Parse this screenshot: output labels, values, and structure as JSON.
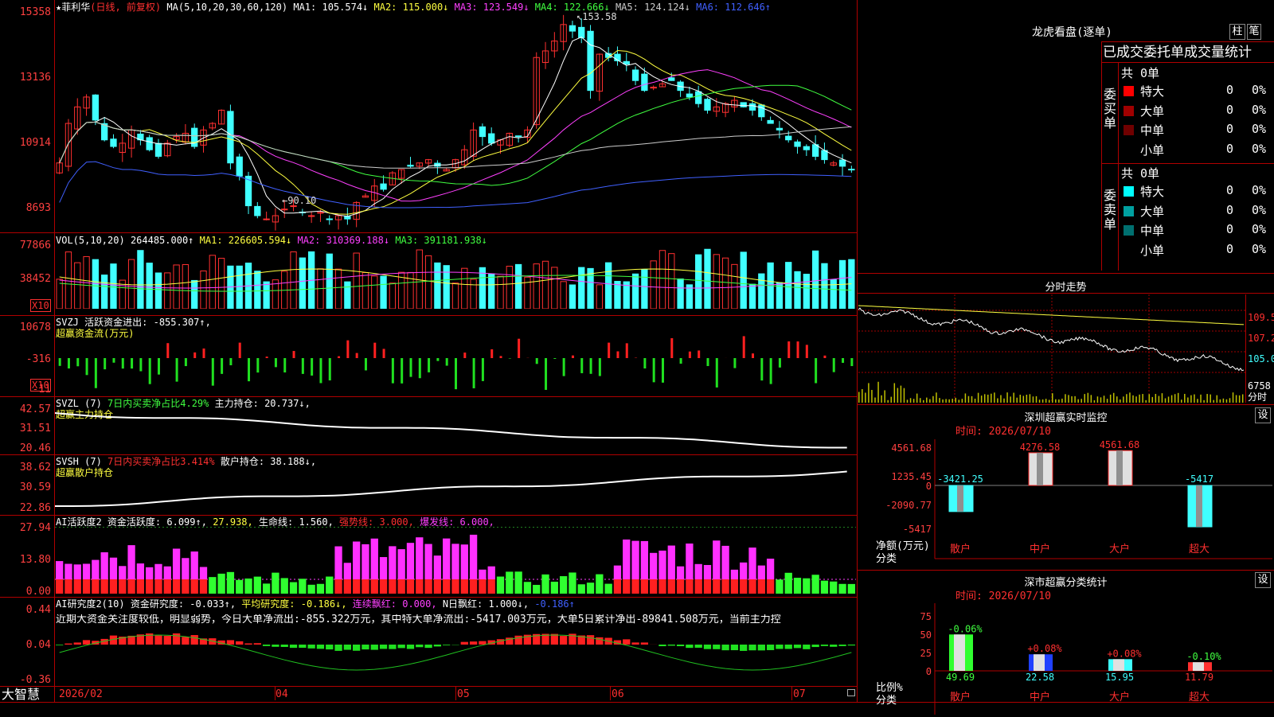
{
  "header": {
    "star": "★",
    "stock_name": "菲利华",
    "chart_mode": "(日线, 前复权)",
    "ma_label": "MA(5,10,20,30,60,120)",
    "ma": [
      {
        "label": "MA1: 105.574↓",
        "color": "#ffffff"
      },
      {
        "label": "MA2: 115.000↓",
        "color": "#ffff40"
      },
      {
        "label": "MA3: 123.549↓",
        "color": "#ff40ff"
      },
      {
        "label": "MA4: 122.666↓",
        "color": "#40ff40"
      },
      {
        "label": "MA5: 124.124↓",
        "color": "#cccccc"
      },
      {
        "label": "MA6: 112.646↑",
        "color": "#4060ff"
      }
    ],
    "high_marker": "153.58",
    "low_marker": "90.10"
  },
  "price_axis": [
    "15358",
    "13136",
    "10914",
    "8693"
  ],
  "vol": {
    "title": "VOL(5,10,20)",
    "value": "264485.000↑",
    "ma1": "MA1: 226605.594↓",
    "ma2": "MA2: 310369.188↓",
    "ma3": "MA3: 391181.938↓",
    "axis": [
      "77866",
      "38452"
    ],
    "unit": "X10"
  },
  "svzj": {
    "title": "SVZJ",
    "desc": "活跃资金进出: -855.307↑,",
    "sub": "超赢资金流(万元)",
    "axis": [
      "10678",
      "-316",
      "-11"
    ],
    "unit": "X10"
  },
  "svzl": {
    "title": "SVZL (7)",
    "desc": "7日内买卖净占比4.29%",
    "value": "主力持仓: 20.737↓,",
    "sub": "超赢主力持仓",
    "axis": [
      "42.57",
      "31.51",
      "20.46"
    ]
  },
  "svsh": {
    "title": "SVSH (7)",
    "desc": "7日内买卖净占比3.414%",
    "value": "散户持仓: 38.188↓,",
    "sub": "超赢散户持仓",
    "axis": [
      "38.62",
      "30.59",
      "22.86"
    ]
  },
  "ai_active": {
    "title": "AI活跃度2",
    "v1": "资金活跃度: 6.099↑,",
    "v2": "27.938,",
    "v3": "生命线: 1.560,",
    "v4": "强势线: 3.000,",
    "v5": "爆发线: 6.000,",
    "axis": [
      "27.94",
      "13.80",
      "0.00"
    ]
  },
  "ai_research": {
    "title": "AI研究度2(10)",
    "v1": "资金研究度: -0.033↑,",
    "v2": "平均研究度: -0.186↓,",
    "v3": "连续飘红: 0.000,",
    "v4": "N日飘红: 1.000↓,",
    "v5": "-0.186↑",
    "comment": "近期大资金关注度较低，明显弱势，今日大单净流出:-855.322万元，其中特大单净流出:-5417.003万元，大单5日累计净出-89841.508万元，当前主力控",
    "axis": [
      "0.44",
      "0.04",
      "-0.36"
    ]
  },
  "x_axis": [
    "2026/02",
    "04",
    "05",
    "06",
    "07"
  ],
  "app_name": "大智慧",
  "right": {
    "lhb_title": "龙虎看盘(逐单)",
    "btn_zhu": "柱",
    "btn_bi": "笔",
    "tabs_header": "已成交委托单成交量统计",
    "buy": {
      "label": "委买单",
      "total": "共 0单",
      "rows": [
        {
          "name": "特大",
          "count": "0",
          "pct": "0%",
          "color": "#ff0000"
        },
        {
          "name": "大单",
          "count": "0",
          "pct": "0%",
          "color": "#a00000"
        },
        {
          "name": "中单",
          "count": "0",
          "pct": "0%",
          "color": "#700000"
        },
        {
          "name": "小单",
          "count": "0",
          "pct": "0%",
          "color": "#000000"
        }
      ]
    },
    "sell": {
      "label": "委卖单",
      "total": "共 0单",
      "rows": [
        {
          "name": "特大",
          "count": "0",
          "pct": "0%",
          "color": "#00ffff"
        },
        {
          "name": "大单",
          "count": "0",
          "pct": "0%",
          "color": "#00a0a0"
        },
        {
          "name": "中单",
          "count": "0",
          "pct": "0%",
          "color": "#007070"
        },
        {
          "name": "小单",
          "count": "0",
          "pct": "0%",
          "color": "#000000"
        }
      ]
    },
    "intraday": {
      "title": "分时走势",
      "axis": [
        "109.5",
        "107.2",
        "105.0",
        "6758"
      ],
      "unit": "分时"
    },
    "sz_monitor": {
      "title": "深圳超赢实时监控",
      "btn": "设",
      "time": "时间: 2026/07/10",
      "axis": [
        "4561.68",
        "1235.45",
        "0",
        "-2090.77",
        "-5417"
      ],
      "net_label": "净额(万元)",
      "cat_label": "分类",
      "categories": [
        "散户",
        "中户",
        "大户",
        "超大"
      ],
      "values": [
        "-3421.25",
        "4276.58",
        "4561.68",
        "-5417"
      ]
    },
    "sz_class": {
      "title": "深市超赢分类统计",
      "btn": "设",
      "time": "时间: 2026/07/10",
      "axis": [
        "75",
        "50",
        "25",
        "0"
      ],
      "ratio_label": "比例%",
      "cat_label": "分类",
      "categories": [
        "散户",
        "中户",
        "大户",
        "超大"
      ],
      "values": [
        "49.69",
        "22.58",
        "15.95",
        "11.79"
      ],
      "changes": [
        "-0.06%",
        "+0.08%",
        "+0.08%",
        "-0.10%"
      ]
    }
  },
  "chart_data": [
    {
      "type": "candlestick",
      "title": "菲利华 (日线, 前复权)",
      "ylim": [
        86.93,
        153.58
      ],
      "candles_close": [
        108,
        120,
        125,
        128,
        121,
        115,
        113,
        114,
        118,
        115,
        112,
        110,
        114,
        116,
        117,
        113,
        118,
        120,
        124,
        108,
        104,
        95,
        92,
        91,
        92,
        94,
        95,
        93,
        92,
        93,
        91,
        92,
        91,
        96,
        98,
        101,
        100,
        105,
        106,
        107,
        108,
        109,
        107,
        106,
        109,
        112,
        118,
        116,
        114,
        115,
        117,
        116,
        118,
        140,
        142,
        145,
        150,
        148,
        146,
        130,
        141,
        140,
        139,
        138,
        133,
        130,
        131,
        132,
        133,
        130,
        128,
        126,
        124,
        125,
        126,
        127,
        125,
        124,
        122,
        120,
        118,
        115,
        113,
        112,
        110,
        109,
        108,
        107,
        106
      ]
    }
  ]
}
